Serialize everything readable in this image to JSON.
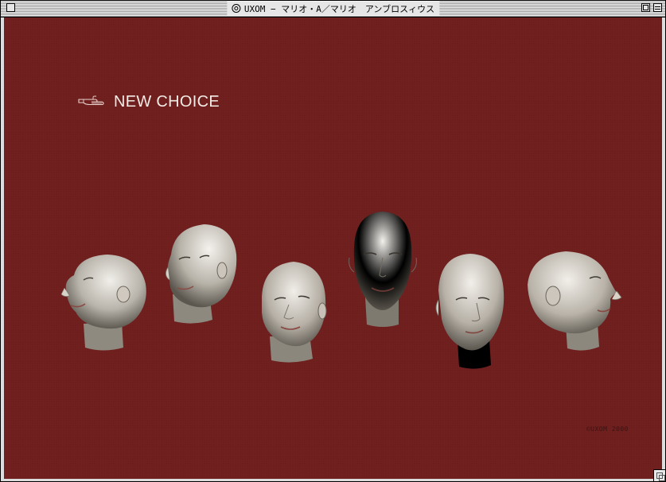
{
  "window": {
    "title": "UXOM − マリオ・A／マリオ　アンブロスィウス"
  },
  "content": {
    "choice_label": "NEW CHOICE",
    "background_color": "#6e1e1c",
    "heads_count": 6,
    "credit": "©UXOM 2000"
  },
  "icons": {
    "pointer": "pointing-hand-icon",
    "title": "window-document-icon"
  }
}
